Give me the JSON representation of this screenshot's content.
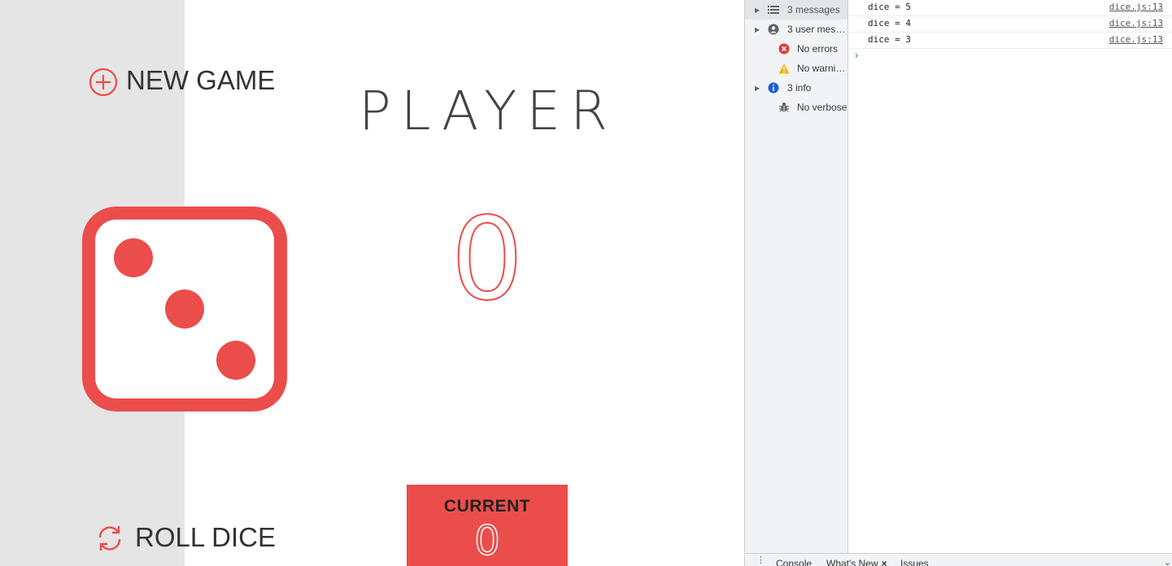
{
  "game": {
    "new_game_label": "NEW GAME",
    "roll_dice_label": "ROLL DICE",
    "player_name": "PLAYER",
    "player_score": "0",
    "current_label": "CURRENT",
    "current_score": "0",
    "dice_face": 3,
    "accent_color": "#eb4d4b",
    "left_panel_color": "#e6e5e5",
    "icons": {
      "new_game": "plus-circle-icon",
      "roll_dice": "refresh-icon"
    }
  },
  "devtools": {
    "sidebar": [
      {
        "label": "3 messages",
        "icon": "list-icon",
        "expandable": true,
        "selected": true
      },
      {
        "label": "3 user mess…",
        "icon": "user-icon",
        "expandable": true,
        "selected": false
      },
      {
        "label": "No errors",
        "icon": "error-icon",
        "expandable": false,
        "selected": false
      },
      {
        "label": "No warnings",
        "icon": "warning-icon",
        "expandable": false,
        "selected": false
      },
      {
        "label": "3 info",
        "icon": "info-icon",
        "expandable": true,
        "selected": false
      },
      {
        "label": "No verbose",
        "icon": "bug-icon",
        "expandable": false,
        "selected": false
      }
    ],
    "logs": [
      {
        "message": "dice = 5",
        "source": "dice.js:13"
      },
      {
        "message": "dice = 4",
        "source": "dice.js:13"
      },
      {
        "message": "dice = 3",
        "source": "dice.js:13"
      }
    ],
    "prompt_symbol": "›",
    "drawer_tabs": {
      "console": "Console",
      "whats_new": "What's New",
      "issues": "Issues"
    }
  }
}
